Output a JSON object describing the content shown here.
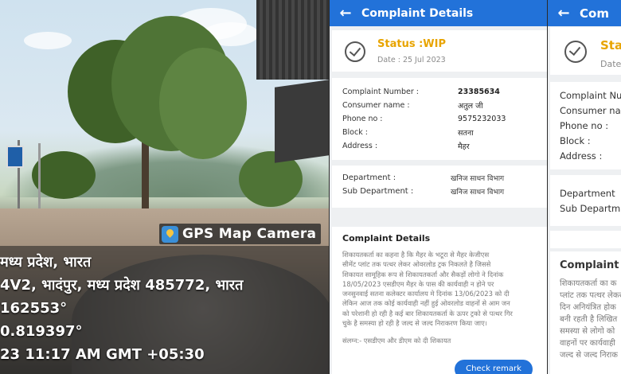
{
  "photo": {
    "overlay_title": "GPS Map Camera",
    "lines": [
      "मध्य प्रदेश, भारत",
      "4V2, भादंपुर, मध्य प्रदेश 485772, भारत",
      "162553°",
      "0.819397°",
      "23 11:17 AM GMT +05:30"
    ]
  },
  "app": {
    "title": "Complaint Details",
    "status": "Status :WIP",
    "date": "Date : 25 Jul 2023",
    "fields": [
      {
        "label": "Complaint Number :",
        "value": "23385634"
      },
      {
        "label": "Consumer name :",
        "value": "अतुल जी"
      },
      {
        "label": "Phone no :",
        "value": "9575232033"
      },
      {
        "label": "Block :",
        "value": "सतना"
      },
      {
        "label": "Address :",
        "value": "मैहर"
      }
    ],
    "department": {
      "label": "Department :",
      "value": "खनिज साधन विभाग"
    },
    "sub_department": {
      "label": "Sub Department :",
      "value": "खनिज साधन विभाग"
    },
    "details_heading": "Complaint Details",
    "details_lines": [
      "शिकायतकर्ता का कहना है कि मैहर के भटूरा से मैहर केजीएस",
      "सीमेंट प्लांट तक पत्थर लेकर ओवरलोड ट्रक निकलते है जिससे",
      "शिकायत सामूहिक रूप से शिकायतकर्ता और सैकड़ों लोगो ने दिनांक",
      "18/05/2023 एसडीएम मैहर के पास की कार्यवाही न होने पर",
      "जनसुनवाई सतना कलेक्टर कार्यालय मे दिनांक 13/06/2023 को दी",
      "लेकिन आज तक कोई कार्यवाही नहीं हुई ओवरलोड वाहनों से आम जन",
      "को परेशानी हो रही है कई बार शिकायतकर्ता के ऊपर ट्रको से पत्थर गिर",
      "चुके है समस्या हो रही है जल्द से जल्द निराकरण किया जाए।"
    ],
    "note": "संलग्न:- एसडीएम और डीएम को दी शिकायत",
    "check_remark": "Check remark"
  },
  "dup": {
    "title": "Com",
    "status": "Statu",
    "date": "Date :",
    "rows": [
      "Complaint Nu",
      "Consumer nar",
      "Phone no :",
      "Block :",
      "Address :"
    ],
    "dept_rows": [
      "Department",
      "Sub Departm"
    ],
    "details_heading": "Complaint D",
    "details_lines": [
      "शिकायतकर्ता का क",
      "प्लांट तक पत्थर लेकर अ",
      "दिन अनियंत्रित होक",
      "बनी रहती है लिखित",
      "समस्या से लोगो को",
      "वाहनों पर कार्यवाही",
      "जल्द से जल्द निराक"
    ]
  },
  "colors": {
    "app_bar": "#2272d9",
    "status": "#e8a400",
    "background": "#eef0f2"
  },
  "icons": [
    "back-arrow-icon",
    "check-circle-icon",
    "map-pin-icon"
  ]
}
